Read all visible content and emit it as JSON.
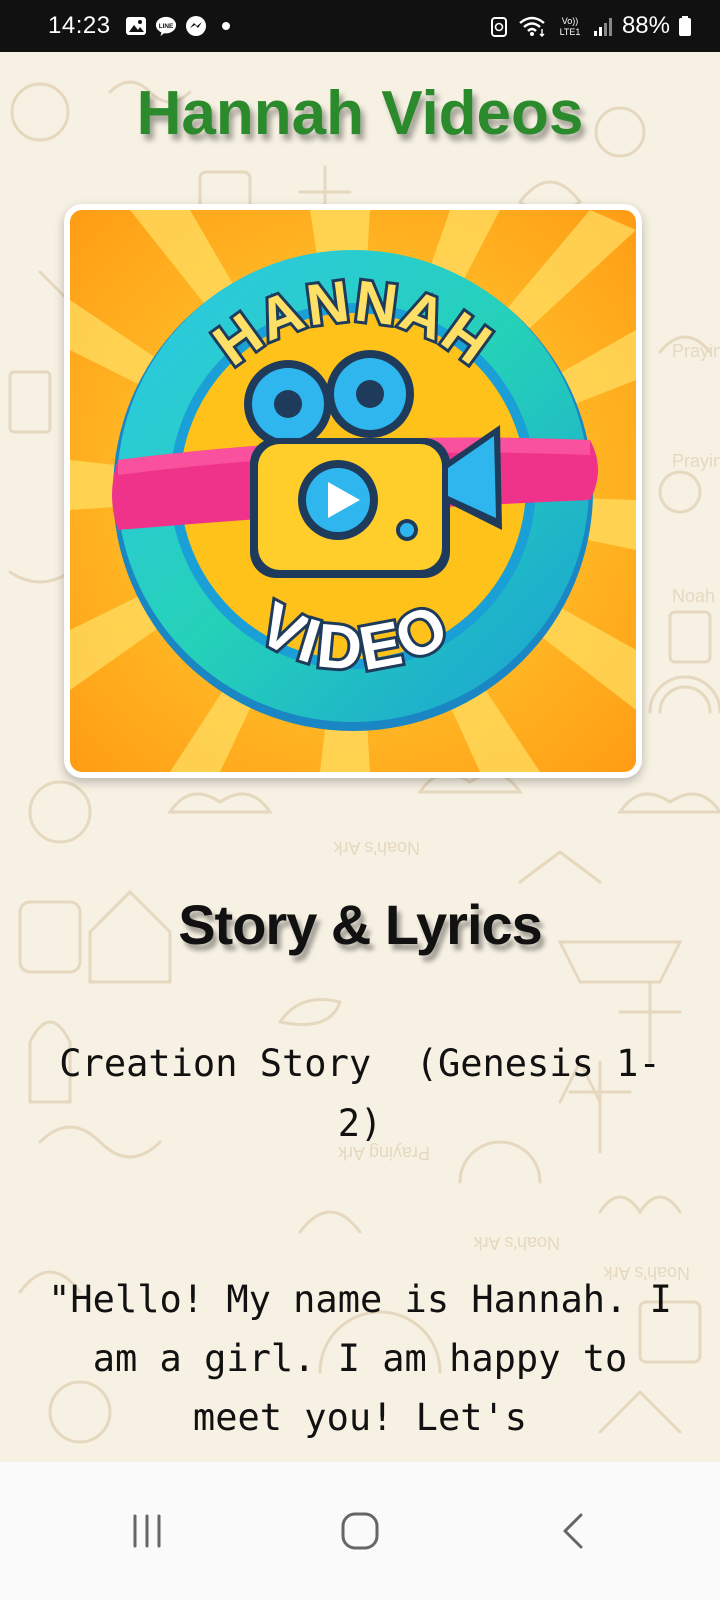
{
  "status_bar": {
    "time": "14:23",
    "left_icons": [
      "gallery-icon",
      "line-icon",
      "messenger-icon",
      "dot-icon"
    ],
    "right_icons": [
      "battery-saver-icon",
      "wifi-icon",
      "volte-icon",
      "signal-icon"
    ],
    "volte_label": "Vo)) LTE1",
    "battery_percent": "88%"
  },
  "app": {
    "title": "Hannah Videos",
    "title_color": "#2b8a2b"
  },
  "logo": {
    "top_text": "HANNAH",
    "bottom_text": "VIDEO",
    "icon": "video-camera-icon"
  },
  "story": {
    "heading": "Story & Lyrics",
    "title": "Creation Story  (Genesis 1-2)",
    "text": "\"Hello! My name is Hannah. I am a girl. I am happy to meet you! Let's"
  },
  "background_doodle_labels": [
    "Noah's Ark",
    "Praying",
    "Noah",
    "Praying Ark"
  ],
  "nav_bar": {
    "buttons": [
      "recent-apps-icon",
      "home-icon",
      "back-icon"
    ]
  }
}
